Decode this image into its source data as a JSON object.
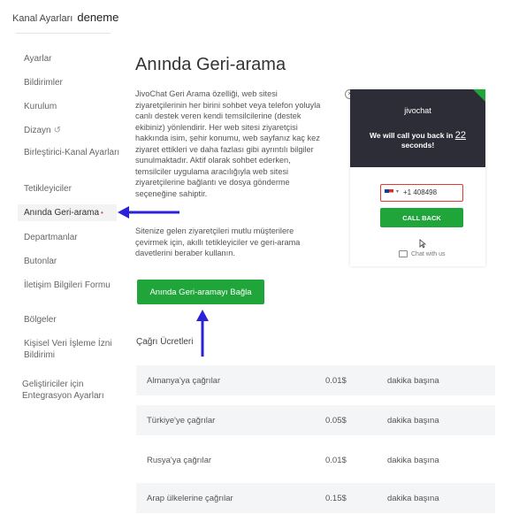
{
  "header": {
    "title": "Kanal Ayarları",
    "channel": "deneme"
  },
  "sidebar": {
    "items": [
      {
        "label": "Ayarlar"
      },
      {
        "label": "Bildirimler"
      },
      {
        "label": "Kurulum"
      },
      {
        "label": "Dizayn"
      },
      {
        "label": "Birleştirici-Kanal Ayarları"
      },
      {
        "label": "Tetikleyiciler"
      },
      {
        "label": "Anında Geri-arama",
        "active": true
      },
      {
        "label": "Departmanlar"
      },
      {
        "label": "Butonlar"
      },
      {
        "label": "İletişim Bilgileri Formu"
      },
      {
        "label": "Bölgeler"
      },
      {
        "label": "Kişisel Veri İşleme İzni Bildirimi"
      },
      {
        "label": "Geliştiriciler için Entegrasyon Ayarları"
      }
    ],
    "active_dot": "•",
    "refresh_icon": "↺"
  },
  "main": {
    "title": "Anında Geri-arama",
    "description1": "JivoChat Geri Arama özelliği, web sitesi ziyaretçilerinin her birini sohbet veya telefon yoluyla canlı destek veren kendi temsilcilerine (destek ekibiniz) yönlendirir. Her web sitesi ziyaretçisi hakkında isim, şehir konumu, web sayfanız kaç kez ziyaret ettikleri ve daha fazlası gibi ayrıntılı bilgiler sunulmaktadır. Aktif olarak sohbet ederken, temsilciler uygulama aracılığıyla web sitesi ziyaretçilerine bağlantı ve dosya gönderme seçeneğine sahiptir.",
    "description2": "Sitenize gelen ziyaretçileri mutlu müşterilere çevirmek için, akıllı tetikleyiciler ve geri-arama davetlerini beraber kullanın.",
    "connect_button": "Anında Geri-aramayı Bağla",
    "calls_title": "Çağrı Ücretleri",
    "rates": [
      {
        "name": "Almanya'ya çağrılar",
        "price": "0.01$",
        "unit": "dakika başına"
      },
      {
        "name": "Türkiye'ye çağrılar",
        "price": "0.05$",
        "unit": "dakika başına"
      },
      {
        "name": "Rusya'ya çağrılar",
        "price": "0.01$",
        "unit": "dakika başına"
      },
      {
        "name": "Arap ülkelerine çağrılar",
        "price": "0.15$",
        "unit": "dakika başına"
      }
    ]
  },
  "preview": {
    "brand": "jivochat",
    "line1": "We will call you back in",
    "seconds": "22",
    "line2": "seconds!",
    "phone_code": "▾",
    "phone": "+1 408498",
    "call_button": "CALL BACK",
    "chat_link": "Chat with us",
    "close": "×"
  },
  "colors": {
    "accent_green": "#1fa53a",
    "arrow_blue": "#2b21d6",
    "dark_panel": "#2d2d37"
  }
}
